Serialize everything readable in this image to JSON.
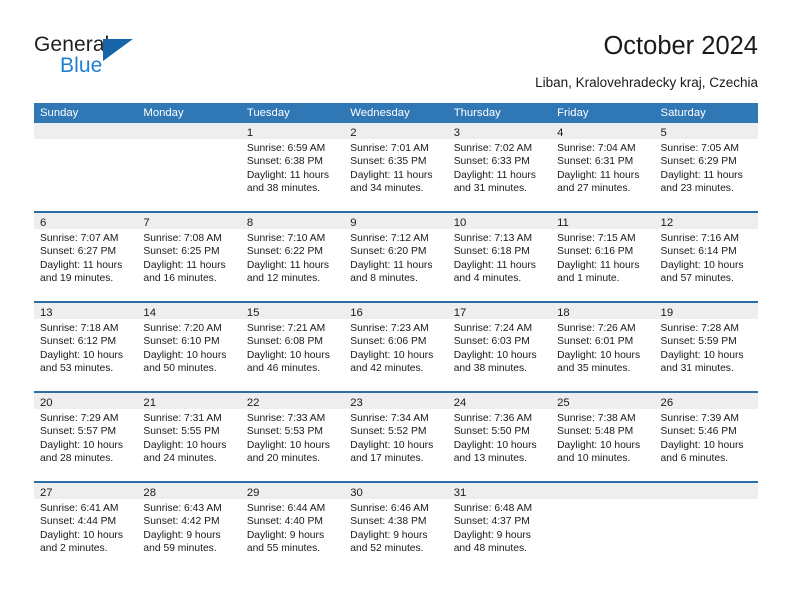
{
  "brand": {
    "name_part1": "General",
    "name_part2": "Blue",
    "triangle_color": "#1565a8",
    "blue_text_color": "#1f7fd4"
  },
  "header": {
    "title": "October 2024",
    "subtitle": "Liban, Kralovehradecky kraj, Czechia"
  },
  "theme": {
    "header_blue": "#3077b5",
    "row_divider_blue": "#2a6da8",
    "day_band_gray": "#eeeeee"
  },
  "calendar": {
    "weekdays": [
      "Sunday",
      "Monday",
      "Tuesday",
      "Wednesday",
      "Thursday",
      "Friday",
      "Saturday"
    ],
    "weeks": [
      [
        {
          "day": "",
          "empty": true
        },
        {
          "day": "",
          "empty": true
        },
        {
          "day": "1",
          "sunrise": "Sunrise: 6:59 AM",
          "sunset": "Sunset: 6:38 PM",
          "daylight": "Daylight: 11 hours and 38 minutes."
        },
        {
          "day": "2",
          "sunrise": "Sunrise: 7:01 AM",
          "sunset": "Sunset: 6:35 PM",
          "daylight": "Daylight: 11 hours and 34 minutes."
        },
        {
          "day": "3",
          "sunrise": "Sunrise: 7:02 AM",
          "sunset": "Sunset: 6:33 PM",
          "daylight": "Daylight: 11 hours and 31 minutes."
        },
        {
          "day": "4",
          "sunrise": "Sunrise: 7:04 AM",
          "sunset": "Sunset: 6:31 PM",
          "daylight": "Daylight: 11 hours and 27 minutes."
        },
        {
          "day": "5",
          "sunrise": "Sunrise: 7:05 AM",
          "sunset": "Sunset: 6:29 PM",
          "daylight": "Daylight: 11 hours and 23 minutes."
        }
      ],
      [
        {
          "day": "6",
          "sunrise": "Sunrise: 7:07 AM",
          "sunset": "Sunset: 6:27 PM",
          "daylight": "Daylight: 11 hours and 19 minutes."
        },
        {
          "day": "7",
          "sunrise": "Sunrise: 7:08 AM",
          "sunset": "Sunset: 6:25 PM",
          "daylight": "Daylight: 11 hours and 16 minutes."
        },
        {
          "day": "8",
          "sunrise": "Sunrise: 7:10 AM",
          "sunset": "Sunset: 6:22 PM",
          "daylight": "Daylight: 11 hours and 12 minutes."
        },
        {
          "day": "9",
          "sunrise": "Sunrise: 7:12 AM",
          "sunset": "Sunset: 6:20 PM",
          "daylight": "Daylight: 11 hours and 8 minutes."
        },
        {
          "day": "10",
          "sunrise": "Sunrise: 7:13 AM",
          "sunset": "Sunset: 6:18 PM",
          "daylight": "Daylight: 11 hours and 4 minutes."
        },
        {
          "day": "11",
          "sunrise": "Sunrise: 7:15 AM",
          "sunset": "Sunset: 6:16 PM",
          "daylight": "Daylight: 11 hours and 1 minute."
        },
        {
          "day": "12",
          "sunrise": "Sunrise: 7:16 AM",
          "sunset": "Sunset: 6:14 PM",
          "daylight": "Daylight: 10 hours and 57 minutes."
        }
      ],
      [
        {
          "day": "13",
          "sunrise": "Sunrise: 7:18 AM",
          "sunset": "Sunset: 6:12 PM",
          "daylight": "Daylight: 10 hours and 53 minutes."
        },
        {
          "day": "14",
          "sunrise": "Sunrise: 7:20 AM",
          "sunset": "Sunset: 6:10 PM",
          "daylight": "Daylight: 10 hours and 50 minutes."
        },
        {
          "day": "15",
          "sunrise": "Sunrise: 7:21 AM",
          "sunset": "Sunset: 6:08 PM",
          "daylight": "Daylight: 10 hours and 46 minutes."
        },
        {
          "day": "16",
          "sunrise": "Sunrise: 7:23 AM",
          "sunset": "Sunset: 6:06 PM",
          "daylight": "Daylight: 10 hours and 42 minutes."
        },
        {
          "day": "17",
          "sunrise": "Sunrise: 7:24 AM",
          "sunset": "Sunset: 6:03 PM",
          "daylight": "Daylight: 10 hours and 38 minutes."
        },
        {
          "day": "18",
          "sunrise": "Sunrise: 7:26 AM",
          "sunset": "Sunset: 6:01 PM",
          "daylight": "Daylight: 10 hours and 35 minutes."
        },
        {
          "day": "19",
          "sunrise": "Sunrise: 7:28 AM",
          "sunset": "Sunset: 5:59 PM",
          "daylight": "Daylight: 10 hours and 31 minutes."
        }
      ],
      [
        {
          "day": "20",
          "sunrise": "Sunrise: 7:29 AM",
          "sunset": "Sunset: 5:57 PM",
          "daylight": "Daylight: 10 hours and 28 minutes."
        },
        {
          "day": "21",
          "sunrise": "Sunrise: 7:31 AM",
          "sunset": "Sunset: 5:55 PM",
          "daylight": "Daylight: 10 hours and 24 minutes."
        },
        {
          "day": "22",
          "sunrise": "Sunrise: 7:33 AM",
          "sunset": "Sunset: 5:53 PM",
          "daylight": "Daylight: 10 hours and 20 minutes."
        },
        {
          "day": "23",
          "sunrise": "Sunrise: 7:34 AM",
          "sunset": "Sunset: 5:52 PM",
          "daylight": "Daylight: 10 hours and 17 minutes."
        },
        {
          "day": "24",
          "sunrise": "Sunrise: 7:36 AM",
          "sunset": "Sunset: 5:50 PM",
          "daylight": "Daylight: 10 hours and 13 minutes."
        },
        {
          "day": "25",
          "sunrise": "Sunrise: 7:38 AM",
          "sunset": "Sunset: 5:48 PM",
          "daylight": "Daylight: 10 hours and 10 minutes."
        },
        {
          "day": "26",
          "sunrise": "Sunrise: 7:39 AM",
          "sunset": "Sunset: 5:46 PM",
          "daylight": "Daylight: 10 hours and 6 minutes."
        }
      ],
      [
        {
          "day": "27",
          "sunrise": "Sunrise: 6:41 AM",
          "sunset": "Sunset: 4:44 PM",
          "daylight": "Daylight: 10 hours and 2 minutes."
        },
        {
          "day": "28",
          "sunrise": "Sunrise: 6:43 AM",
          "sunset": "Sunset: 4:42 PM",
          "daylight": "Daylight: 9 hours and 59 minutes."
        },
        {
          "day": "29",
          "sunrise": "Sunrise: 6:44 AM",
          "sunset": "Sunset: 4:40 PM",
          "daylight": "Daylight: 9 hours and 55 minutes."
        },
        {
          "day": "30",
          "sunrise": "Sunrise: 6:46 AM",
          "sunset": "Sunset: 4:38 PM",
          "daylight": "Daylight: 9 hours and 52 minutes."
        },
        {
          "day": "31",
          "sunrise": "Sunrise: 6:48 AM",
          "sunset": "Sunset: 4:37 PM",
          "daylight": "Daylight: 9 hours and 48 minutes."
        },
        {
          "day": "",
          "empty": true
        },
        {
          "day": "",
          "empty": true
        }
      ]
    ]
  }
}
